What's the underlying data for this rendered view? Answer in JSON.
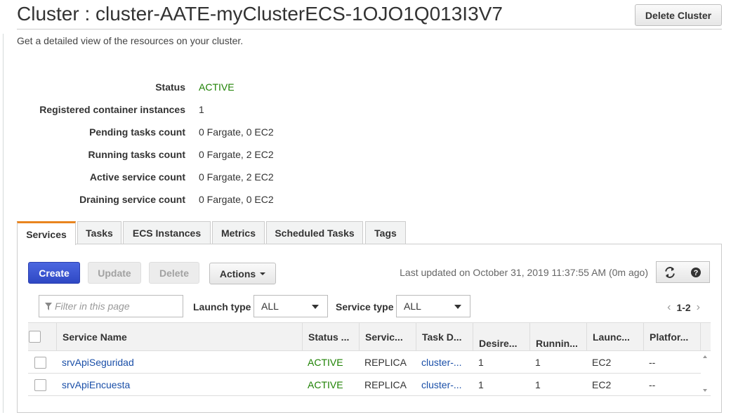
{
  "page": {
    "title": "Cluster : cluster-AATE-myClusterECS-1OJO1Q013I3V7",
    "description": "Get a detailed view of the resources on your cluster.",
    "delete_cluster_label": "Delete Cluster"
  },
  "details": [
    {
      "label": "Status",
      "value": "ACTIVE"
    },
    {
      "label": "Registered container instances",
      "value": "1"
    },
    {
      "label": "Pending tasks count",
      "value": "0 Fargate, 0 EC2"
    },
    {
      "label": "Running tasks count",
      "value": "0 Fargate, 2 EC2"
    },
    {
      "label": "Active service count",
      "value": "0 Fargate, 2 EC2"
    },
    {
      "label": "Draining service count",
      "value": "0 Fargate, 0 EC2"
    }
  ],
  "tabs": [
    "Services",
    "Tasks",
    "ECS Instances",
    "Metrics",
    "Scheduled Tasks",
    "Tags"
  ],
  "selected_tab": "Services",
  "toolbar": {
    "create_label": "Create",
    "update_label": "Update",
    "delete_label": "Delete",
    "actions_label": "Actions",
    "last_updated": "Last updated on October 31, 2019 11:37:55 AM (0m ago)",
    "refresh_icon": "refresh-icon",
    "help_icon": "help-icon"
  },
  "filters": {
    "filter_placeholder": "Filter in this page",
    "launch_type_label": "Launch type",
    "launch_type_value": "ALL",
    "service_type_label": "Service type",
    "service_type_value": "ALL",
    "page_range": "1-2"
  },
  "table": {
    "columns": [
      "Service Name",
      "Status ...",
      "Servic...",
      "Task D...",
      "Desire...",
      "Runnin...",
      "Launc...",
      "Platfor..."
    ],
    "rows": [
      {
        "service_name": "srvApiSeguridad",
        "status": "ACTIVE",
        "service_type": "REPLICA",
        "task_definition": "cluster-...",
        "desired": "1",
        "running": "1",
        "launch_type": "EC2",
        "platform": "--"
      },
      {
        "service_name": "srvApiEncuesta",
        "status": "ACTIVE",
        "service_type": "REPLICA",
        "task_definition": "cluster-...",
        "desired": "1",
        "running": "1",
        "launch_type": "EC2",
        "platform": "--"
      }
    ]
  },
  "colors": {
    "active_status": "#1d8102",
    "primary_button": "#3f57d1",
    "link": "#1a4fa8",
    "selected_tab_accent": "#e9851f"
  }
}
